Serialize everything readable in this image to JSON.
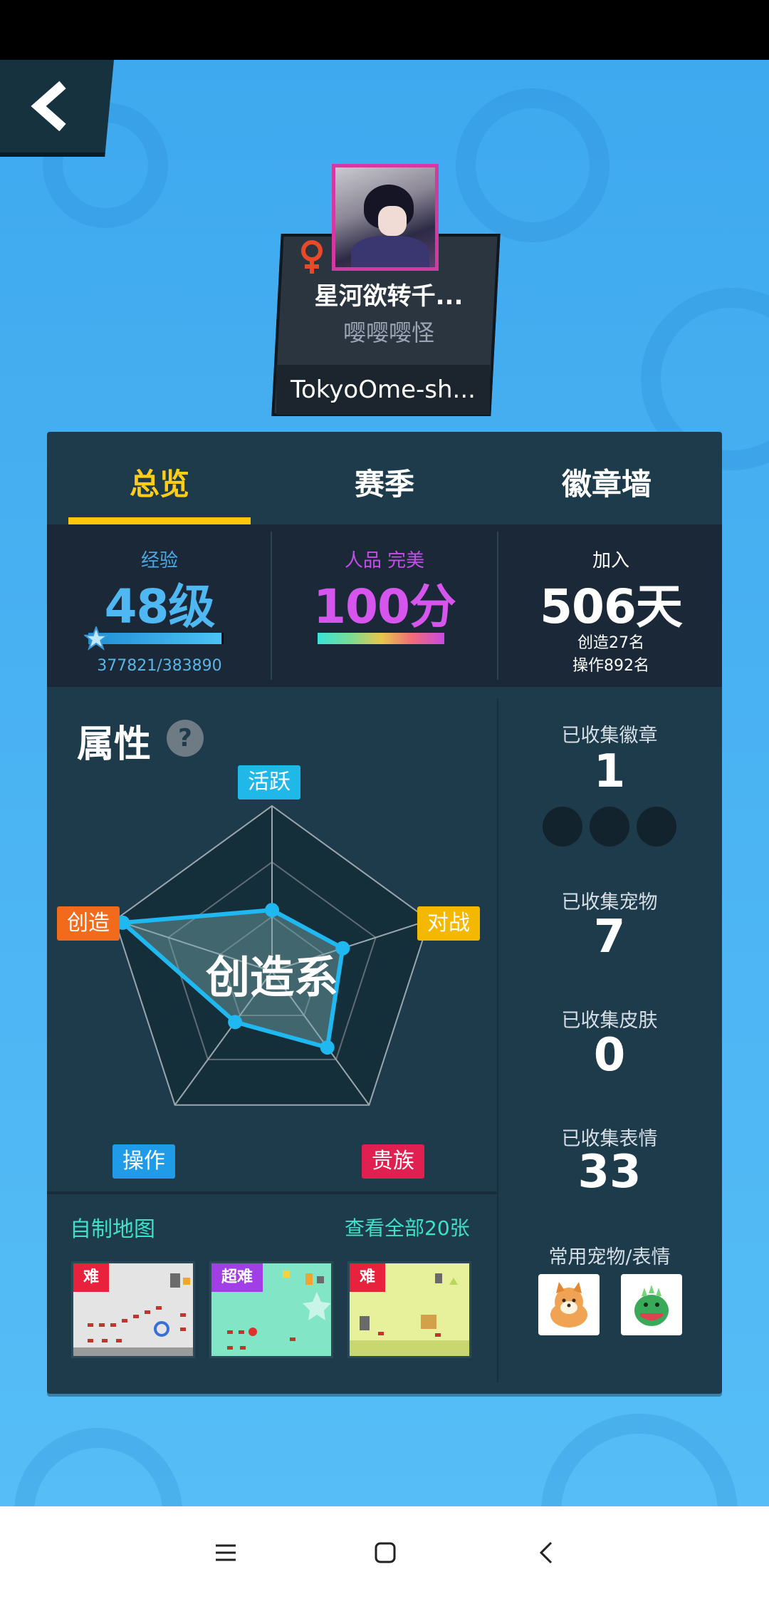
{
  "profile": {
    "nickname": "星河欲转千...",
    "title": "嘤嘤嘤怪",
    "uid": "TokyoOme-sh..."
  },
  "tabs": [
    {
      "label": "总览",
      "active": true
    },
    {
      "label": "赛季",
      "active": false
    },
    {
      "label": "徽章墙",
      "active": false
    }
  ],
  "stats": {
    "experience": {
      "label": "经验",
      "value": "48级",
      "progress_text": "377821/383890",
      "progress_fraction": 0.984
    },
    "rp": {
      "label": "人品 完美",
      "value": "100分"
    },
    "joined": {
      "label": "加入",
      "value": "506天",
      "create_rank": "创造27名",
      "operate_rank": "操作892名"
    }
  },
  "attributes": {
    "title": "属性",
    "help": "?",
    "center_label": "创造系",
    "axes": [
      {
        "name": "活跃",
        "color": "#1fb8e8",
        "value": 0.37
      },
      {
        "name": "对战",
        "color": "#f5b800",
        "value": 0.45
      },
      {
        "name": "贵族",
        "color": "#e02050",
        "value": 0.57
      },
      {
        "name": "操作",
        "color": "#1f9be8",
        "value": 0.38
      },
      {
        "name": "创造",
        "color": "#f26a1b",
        "value": 0.95
      }
    ]
  },
  "collection": {
    "badges_label": "已收集徽章",
    "badges_value": "1",
    "pets_label": "已收集宠物",
    "pets_value": "7",
    "skins_label": "已收集皮肤",
    "skins_value": "0",
    "emotes_label": "已收集表情",
    "emotes_value": "33",
    "favorites_label": "常用宠物/表情"
  },
  "maps": {
    "title": "自制地图",
    "view_all": "查看全部20张",
    "items": [
      {
        "tag": "难",
        "tag_color": "#e8223c"
      },
      {
        "tag": "超难",
        "tag_color": "#a23ee6"
      },
      {
        "tag": "难",
        "tag_color": "#e8223c"
      }
    ]
  }
}
